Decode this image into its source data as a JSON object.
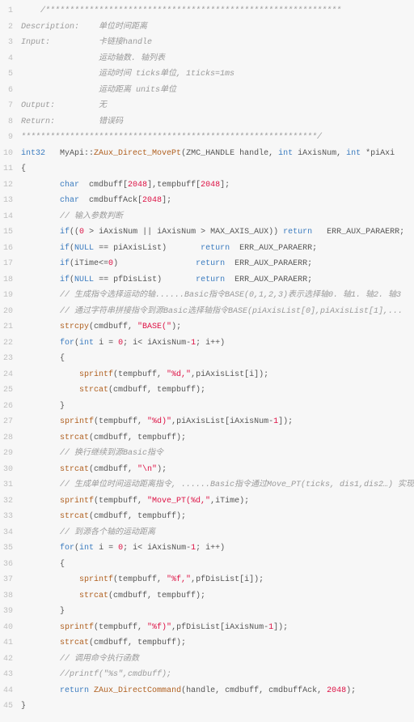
{
  "lines": [
    {
      "n": 1,
      "ind": 1,
      "tokens": [
        {
          "c": "cm",
          "t": "/*************************************************************"
        }
      ]
    },
    {
      "n": 2,
      "ind": 0,
      "tokens": [
        {
          "c": "cm",
          "t": "Description:    单位时间距离"
        }
      ]
    },
    {
      "n": 3,
      "ind": 0,
      "tokens": [
        {
          "c": "cm",
          "t": "Input:          卡链接handle"
        }
      ]
    },
    {
      "n": 4,
      "ind": 0,
      "tokens": [
        {
          "c": "cm",
          "t": "                运动轴数. 轴列表"
        }
      ]
    },
    {
      "n": 5,
      "ind": 0,
      "tokens": [
        {
          "c": "cm",
          "t": "                运动时间 ticks单位, 1ticks=1ms"
        }
      ]
    },
    {
      "n": 6,
      "ind": 0,
      "tokens": [
        {
          "c": "cm",
          "t": "                运动距离 units单位"
        }
      ]
    },
    {
      "n": 7,
      "ind": 0,
      "tokens": [
        {
          "c": "cm",
          "t": "Output:         无"
        }
      ]
    },
    {
      "n": 8,
      "ind": 0,
      "tokens": [
        {
          "c": "cm",
          "t": "Return:         错误码"
        }
      ]
    },
    {
      "n": 9,
      "ind": 0,
      "tokens": [
        {
          "c": "cm",
          "t": "*************************************************************/"
        }
      ]
    },
    {
      "n": 10,
      "ind": 0,
      "tokens": [
        {
          "c": "ty",
          "t": "int32"
        },
        {
          "c": "id",
          "t": "   MyApi::"
        },
        {
          "c": "fn",
          "t": "ZAux_Direct_MovePt"
        },
        {
          "c": "id",
          "t": "(ZMC_HANDLE handle, "
        },
        {
          "c": "ty",
          "t": "int"
        },
        {
          "c": "id",
          "t": " iAxisNum, "
        },
        {
          "c": "ty",
          "t": "int"
        },
        {
          "c": "id",
          "t": " *piAxi"
        }
      ]
    },
    {
      "n": 11,
      "ind": 0,
      "tokens": [
        {
          "c": "id",
          "t": "{"
        }
      ]
    },
    {
      "n": 12,
      "ind": 2,
      "tokens": [
        {
          "c": "ty",
          "t": "char"
        },
        {
          "c": "id",
          "t": "  cmdbuff["
        },
        {
          "c": "num",
          "t": "2048"
        },
        {
          "c": "id",
          "t": "],tempbuff["
        },
        {
          "c": "num",
          "t": "2048"
        },
        {
          "c": "id",
          "t": "];"
        }
      ]
    },
    {
      "n": 13,
      "ind": 2,
      "tokens": [
        {
          "c": "ty",
          "t": "char"
        },
        {
          "c": "id",
          "t": "  cmdbuffAck["
        },
        {
          "c": "num",
          "t": "2048"
        },
        {
          "c": "id",
          "t": "];"
        }
      ]
    },
    {
      "n": 14,
      "ind": 2,
      "tokens": [
        {
          "c": "cm",
          "t": "// 输入参数判断"
        }
      ]
    },
    {
      "n": 15,
      "ind": 2,
      "tokens": [
        {
          "c": "kw",
          "t": "if"
        },
        {
          "c": "id",
          "t": "(("
        },
        {
          "c": "num",
          "t": "0"
        },
        {
          "c": "id",
          "t": " > iAxisNum || iAxisNum > MAX_AXIS_AUX)) "
        },
        {
          "c": "ret",
          "t": "return"
        },
        {
          "c": "id",
          "t": "   ERR_AUX_PARAERR;"
        }
      ]
    },
    {
      "n": 16,
      "ind": 2,
      "tokens": [
        {
          "c": "kw",
          "t": "if"
        },
        {
          "c": "id",
          "t": "("
        },
        {
          "c": "null",
          "t": "NULL"
        },
        {
          "c": "id",
          "t": " == piAxisList)       "
        },
        {
          "c": "ret",
          "t": "return"
        },
        {
          "c": "id",
          "t": "  ERR_AUX_PARAERR;"
        }
      ]
    },
    {
      "n": 17,
      "ind": 2,
      "tokens": [
        {
          "c": "kw",
          "t": "if"
        },
        {
          "c": "id",
          "t": "(iTime<="
        },
        {
          "c": "num",
          "t": "0"
        },
        {
          "c": "id",
          "t": ")                "
        },
        {
          "c": "ret",
          "t": "return"
        },
        {
          "c": "id",
          "t": "  ERR_AUX_PARAERR;"
        }
      ]
    },
    {
      "n": 18,
      "ind": 2,
      "tokens": [
        {
          "c": "kw",
          "t": "if"
        },
        {
          "c": "id",
          "t": "("
        },
        {
          "c": "null",
          "t": "NULL"
        },
        {
          "c": "id",
          "t": " == pfDisList)       "
        },
        {
          "c": "ret",
          "t": "return"
        },
        {
          "c": "id",
          "t": "  ERR_AUX_PARAERR;"
        }
      ]
    },
    {
      "n": 19,
      "ind": 2,
      "tokens": [
        {
          "c": "cm",
          "t": "// 生成指令选择运动的轴......Basic指令BASE(0,1,2,3)表示选择轴0. 轴1. 轴2. 轴3"
        }
      ]
    },
    {
      "n": 20,
      "ind": 2,
      "tokens": [
        {
          "c": "cm",
          "t": "// 通过字符串拼接指令到源Basic选择轴指令BASE(piAxisList[0],piAxisList[1],..."
        }
      ]
    },
    {
      "n": 21,
      "ind": 2,
      "tokens": [
        {
          "c": "fn",
          "t": "strcpy"
        },
        {
          "c": "id",
          "t": "(cmdbuff, "
        },
        {
          "c": "str",
          "t": "\"BASE(\""
        },
        {
          "c": "id",
          "t": ");"
        }
      ]
    },
    {
      "n": 22,
      "ind": 2,
      "tokens": [
        {
          "c": "kw",
          "t": "for"
        },
        {
          "c": "id",
          "t": "("
        },
        {
          "c": "ty",
          "t": "int"
        },
        {
          "c": "id",
          "t": " i = "
        },
        {
          "c": "num",
          "t": "0"
        },
        {
          "c": "id",
          "t": "; i< iAxisNum-"
        },
        {
          "c": "num",
          "t": "1"
        },
        {
          "c": "id",
          "t": "; i++)"
        }
      ]
    },
    {
      "n": 23,
      "ind": 2,
      "tokens": [
        {
          "c": "id",
          "t": "{"
        }
      ]
    },
    {
      "n": 24,
      "ind": 3,
      "tokens": [
        {
          "c": "fn",
          "t": "sprintf"
        },
        {
          "c": "id",
          "t": "(tempbuff, "
        },
        {
          "c": "str",
          "t": "\"%d,\""
        },
        {
          "c": "id",
          "t": ",piAxisList[i]);"
        }
      ]
    },
    {
      "n": 25,
      "ind": 3,
      "tokens": [
        {
          "c": "fn",
          "t": "strcat"
        },
        {
          "c": "id",
          "t": "(cmdbuff, tempbuff);"
        }
      ]
    },
    {
      "n": 26,
      "ind": 2,
      "tokens": [
        {
          "c": "id",
          "t": "}"
        }
      ]
    },
    {
      "n": 27,
      "ind": 2,
      "tokens": [
        {
          "c": "fn",
          "t": "sprintf"
        },
        {
          "c": "id",
          "t": "(tempbuff, "
        },
        {
          "c": "str",
          "t": "\"%d)\""
        },
        {
          "c": "id",
          "t": ",piAxisList[iAxisNum-"
        },
        {
          "c": "num",
          "t": "1"
        },
        {
          "c": "id",
          "t": "]);"
        }
      ]
    },
    {
      "n": 28,
      "ind": 2,
      "tokens": [
        {
          "c": "fn",
          "t": "strcat"
        },
        {
          "c": "id",
          "t": "(cmdbuff, tempbuff);"
        }
      ]
    },
    {
      "n": 29,
      "ind": 2,
      "tokens": [
        {
          "c": "cm",
          "t": "// 换行继续到源Basic指令"
        }
      ]
    },
    {
      "n": 30,
      "ind": 2,
      "tokens": [
        {
          "c": "fn",
          "t": "strcat"
        },
        {
          "c": "id",
          "t": "(cmdbuff, "
        },
        {
          "c": "str",
          "t": "\"\\n\""
        },
        {
          "c": "id",
          "t": ");"
        }
      ]
    },
    {
      "n": 31,
      "ind": 2,
      "tokens": [
        {
          "c": "cm",
          "t": "// 生成单位时间运动距离指令, ......Basic指令通过Move_PT(ticks, dis1,dis2…) 实现"
        }
      ]
    },
    {
      "n": 32,
      "ind": 2,
      "tokens": [
        {
          "c": "fn",
          "t": "sprintf"
        },
        {
          "c": "id",
          "t": "(tempbuff, "
        },
        {
          "c": "str",
          "t": "\"Move_PT(%d,\""
        },
        {
          "c": "id",
          "t": ",iTime);"
        }
      ]
    },
    {
      "n": 33,
      "ind": 2,
      "tokens": [
        {
          "c": "fn",
          "t": "strcat"
        },
        {
          "c": "id",
          "t": "(cmdbuff, tempbuff);"
        }
      ]
    },
    {
      "n": 34,
      "ind": 2,
      "tokens": [
        {
          "c": "cm",
          "t": "// 到源各个轴的运动距离"
        }
      ]
    },
    {
      "n": 35,
      "ind": 2,
      "tokens": [
        {
          "c": "kw",
          "t": "for"
        },
        {
          "c": "id",
          "t": "("
        },
        {
          "c": "ty",
          "t": "int"
        },
        {
          "c": "id",
          "t": " i = "
        },
        {
          "c": "num",
          "t": "0"
        },
        {
          "c": "id",
          "t": "; i< iAxisNum-"
        },
        {
          "c": "num",
          "t": "1"
        },
        {
          "c": "id",
          "t": "; i++)"
        }
      ]
    },
    {
      "n": 36,
      "ind": 2,
      "tokens": [
        {
          "c": "id",
          "t": "{"
        }
      ]
    },
    {
      "n": 37,
      "ind": 3,
      "tokens": [
        {
          "c": "fn",
          "t": "sprintf"
        },
        {
          "c": "id",
          "t": "(tempbuff, "
        },
        {
          "c": "str",
          "t": "\"%f,\""
        },
        {
          "c": "id",
          "t": ",pfDisList[i]);"
        }
      ]
    },
    {
      "n": 38,
      "ind": 3,
      "tokens": [
        {
          "c": "fn",
          "t": "strcat"
        },
        {
          "c": "id",
          "t": "(cmdbuff, tempbuff);"
        }
      ]
    },
    {
      "n": 39,
      "ind": 2,
      "tokens": [
        {
          "c": "id",
          "t": "}"
        }
      ]
    },
    {
      "n": 40,
      "ind": 2,
      "tokens": [
        {
          "c": "fn",
          "t": "sprintf"
        },
        {
          "c": "id",
          "t": "(tempbuff, "
        },
        {
          "c": "str",
          "t": "\"%f)\""
        },
        {
          "c": "id",
          "t": ",pfDisList[iAxisNum-"
        },
        {
          "c": "num",
          "t": "1"
        },
        {
          "c": "id",
          "t": "]);"
        }
      ]
    },
    {
      "n": 41,
      "ind": 2,
      "tokens": [
        {
          "c": "fn",
          "t": "strcat"
        },
        {
          "c": "id",
          "t": "(cmdbuff, tempbuff);"
        }
      ]
    },
    {
      "n": 42,
      "ind": 2,
      "tokens": [
        {
          "c": "cm",
          "t": "// 调用命令执行函数"
        }
      ]
    },
    {
      "n": 43,
      "ind": 2,
      "tokens": [
        {
          "c": "cm",
          "t": "//printf(\"%s\",cmdbuff);"
        }
      ]
    },
    {
      "n": 44,
      "ind": 2,
      "tokens": [
        {
          "c": "ret",
          "t": "return"
        },
        {
          "c": "id",
          "t": " "
        },
        {
          "c": "fn",
          "t": "ZAux_DirectCommand"
        },
        {
          "c": "id",
          "t": "(handle, cmdbuff, cmdbuffAck, "
        },
        {
          "c": "num",
          "t": "2048"
        },
        {
          "c": "id",
          "t": ");"
        }
      ]
    },
    {
      "n": 45,
      "ind": 0,
      "tokens": [
        {
          "c": "id",
          "t": "}"
        }
      ]
    }
  ],
  "indent_unit": "    "
}
